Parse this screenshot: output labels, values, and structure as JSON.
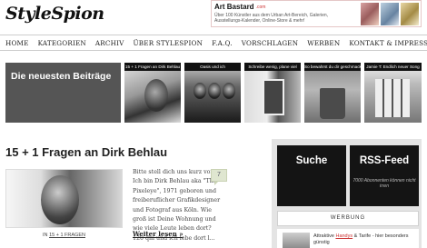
{
  "site": {
    "logo": "StyleSpion"
  },
  "top_ad": {
    "brand": "Art Bastard",
    "site": ".com",
    "text": "Über 100 Künstler aus dem Urban Art-Bereich, Galerien, Ausstellungs-Kalender, Online-Store & mehr!"
  },
  "nav": {
    "items": [
      "HOME",
      "KATEGORIEN",
      "ARCHIV",
      "ÜBER STYLESPION",
      "F.A.Q.",
      "VORSCHLAGEN",
      "WERBEN",
      "KONTAKT & IMPRESSUM"
    ]
  },
  "featured": {
    "lead_label": "Die neuesten Beiträge",
    "thumbs": [
      {
        "caption": "15 + 1 Fragen an Dirk Behlau"
      },
      {
        "caption": "Oasis und ich"
      },
      {
        "caption": "Schreibe wenig, plane viel"
      },
      {
        "caption": "So bewahrst du dir geschmackvolles Kleiderschränke: Die Bücherbörse"
      },
      {
        "caption": "Jamie T: Endlich neuer Song"
      }
    ]
  },
  "post": {
    "title": "15 + 1 Fragen an Dirk Behlau",
    "category_prefix": "IN",
    "category": "15 + 1 FRAGEN",
    "excerpt": "Bitte stell dich uns kurz vor Ich bin Dirk Behlau aka \"The Pixeleye\", 1971 geboren und freiberuflicher Grafikdesigner und Fotograf aus Köln. Wie groß ist Deine Wohnung und wie viele Leute leben dort? 120 qm und ich lebe dort l...",
    "read_more": "Weiter lesen »",
    "comment_count": "7"
  },
  "sidebar": {
    "search_label": "Suche",
    "rss_label": "RSS-Feed",
    "rss_sub": "7000 Abonnenten können nicht irren",
    "ad_heading": "WERBUNG",
    "ad_text_pre": "Attraktive",
    "ad_text_link": "Handys",
    "ad_text_post": "& Tarife - hier besonders günstig"
  }
}
